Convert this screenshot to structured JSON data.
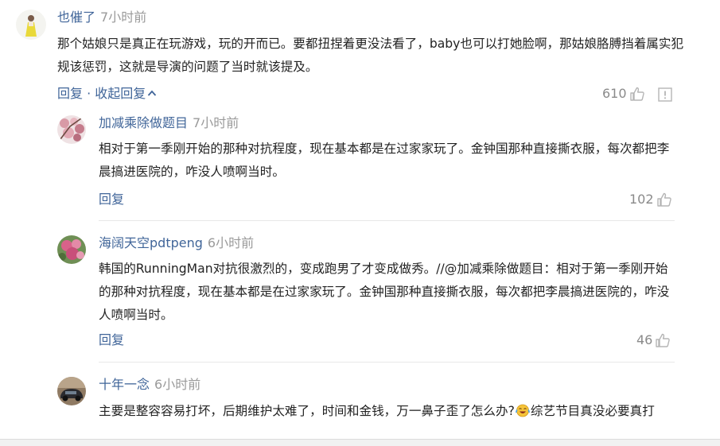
{
  "comments": [
    {
      "username": "也催了",
      "time": "7小时前",
      "text": "那个姑娘只是真正在玩游戏，玩的开而已。要都扭捏着更没法看了，baby也可以打她脸啊，那姑娘胳膊挡着属实犯规该惩罚，这就是导演的问题了当时就该提及。",
      "reply_label": "回复",
      "separator": " · ",
      "collapse_label": "收起回复",
      "likes": "610"
    }
  ],
  "replies": [
    {
      "username": "加减乘除做题目",
      "time": "7小时前",
      "text": "相对于第一季刚开始的那种对抗程度，现在基本都是在过家家玩了。金钟国那种直接撕衣服，每次都把李晨搞进医院的，咋没人喷啊当时。",
      "reply_label": "回复",
      "likes": "102"
    },
    {
      "username": "海阔天空pdtpeng",
      "time": "6小时前",
      "text": "韩国的RunningMan对抗很激烈的，变成跑男了才变成做秀。//@加减乘除做题目：相对于第一季刚开始的那种对抗程度，现在基本都是在过家家玩了。金钟国那种直接撕衣服，每次都把李晨搞进医院的，咋没人喷啊当时。",
      "reply_label": "回复",
      "likes": "46"
    },
    {
      "username": "十年一念",
      "time": "6小时前",
      "text_before_emoji": "主要是整容容易打坏，后期维护太难了，时间和金钱，万一鼻子歪了怎么办?",
      "text_after_emoji": "综艺节目真没必要真打"
    }
  ],
  "icons": {
    "like": "thumbs-up-icon",
    "report": "report-icon",
    "collapse": "chevron-up-icon",
    "emoji": "crying-laughing-emoji"
  },
  "colors": {
    "link": "#406599",
    "text": "#222222",
    "muted": "#9a9a9a",
    "icon": "#b5b5b5"
  }
}
